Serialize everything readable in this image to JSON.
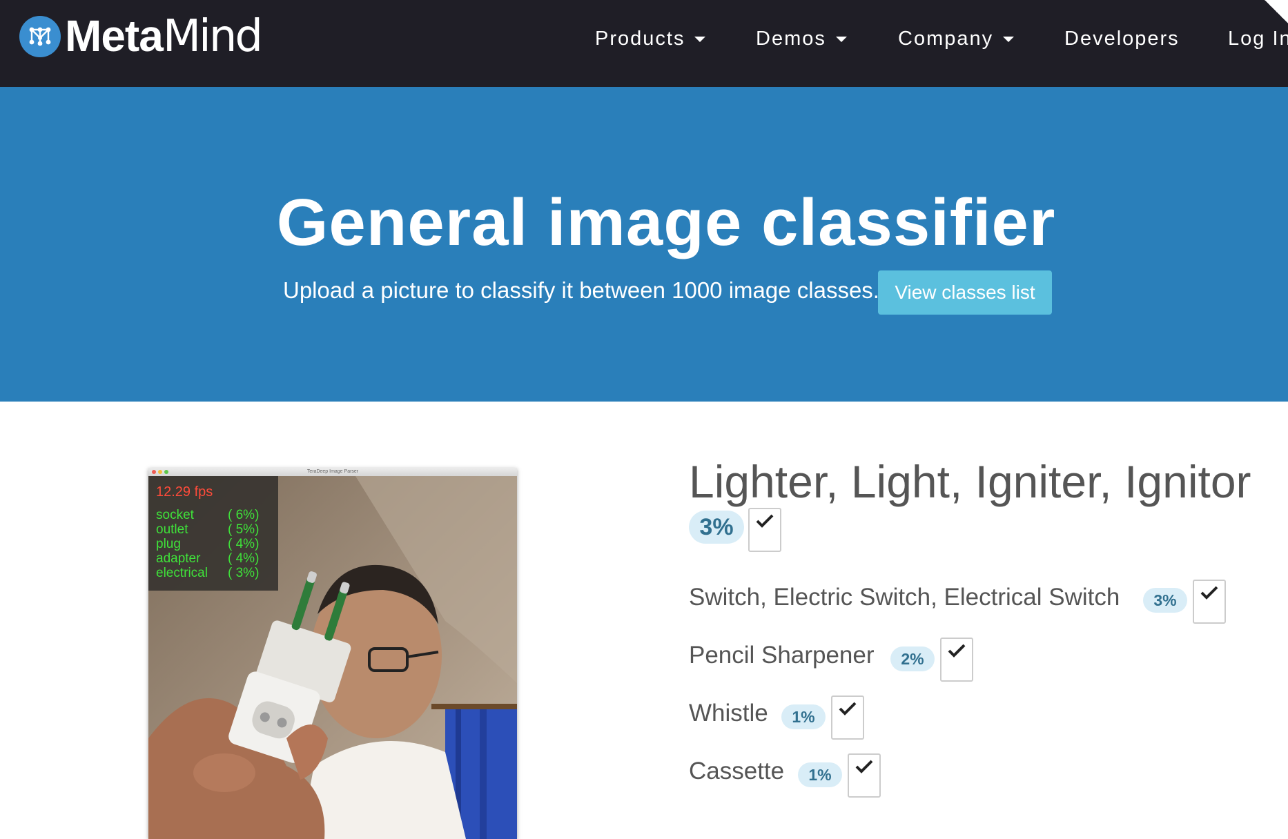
{
  "brand": {
    "name_bold": "Meta",
    "name_light": "Mind"
  },
  "nav": [
    {
      "label": "Products",
      "dropdown": true
    },
    {
      "label": "Demos",
      "dropdown": true
    },
    {
      "label": "Company",
      "dropdown": true
    },
    {
      "label": "Developers",
      "dropdown": false
    },
    {
      "label": "Log In",
      "dropdown": false
    }
  ],
  "hero": {
    "title": "General image classifier",
    "subtitle": "Upload a picture to classify it between 1000 image classes.",
    "button_label": "View classes list"
  },
  "uploaded_image": {
    "window_title": "TeraDeep Image Parser",
    "fps": "12.29 fps",
    "detections": [
      {
        "label": "socket",
        "pct": "( 6%)"
      },
      {
        "label": "outlet",
        "pct": "( 5%)"
      },
      {
        "label": "plug",
        "pct": "( 4%)"
      },
      {
        "label": "adapter",
        "pct": "( 4%)"
      },
      {
        "label": "electrical",
        "pct": "( 3%)"
      }
    ]
  },
  "predictions": {
    "top": {
      "label": "Lighter, Light, Igniter, Ignitor",
      "pct": "3%"
    },
    "others": [
      {
        "label": "Switch, Electric Switch, Electrical Switch",
        "pct": "3%"
      },
      {
        "label": "Pencil Sharpener",
        "pct": "2%"
      },
      {
        "label": "Whistle",
        "pct": "1%"
      },
      {
        "label": "Cassette",
        "pct": "1%"
      }
    ]
  },
  "colors": {
    "navbar": "#1f1e26",
    "hero": "#2a7fba",
    "button": "#5bc0de",
    "badge_bg": "#d9edf7",
    "badge_text": "#31708f"
  }
}
